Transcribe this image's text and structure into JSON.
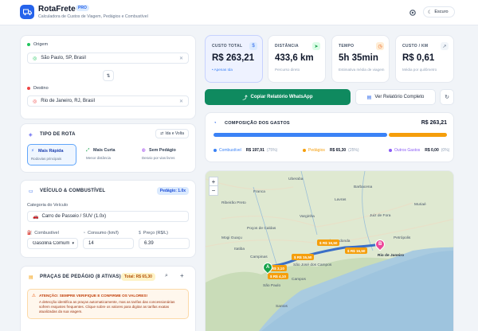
{
  "app": {
    "brand": "RotaFrete",
    "badge": "PRO",
    "tagline": "Calculadora de Custos de Viagem, Pedágios e Combustível",
    "theme_button": "Escuro"
  },
  "route": {
    "origin_label": "Origem",
    "origin_value": "São Paulo, SP, Brasil",
    "destination_label": "Destino",
    "destination_value": "Rio de Janeiro, RJ, Brasil"
  },
  "route_type": {
    "title": "TIPO DE ROTA",
    "roundtrip_button": "Ida e Volta",
    "options": [
      {
        "label": "Mais Rápida",
        "sub": "Rodovias principais"
      },
      {
        "label": "Mais Curta",
        "sub": "Menor distância"
      },
      {
        "label": "Sem Pedágio",
        "sub": "Desvio por vias livres"
      }
    ]
  },
  "vehicle": {
    "title": "VEÍCULO & COMBUSTÍVEL",
    "toll_badge": "Pedágio: 1.0x",
    "category_label": "Categoria do Veículo",
    "category_value": "Carro de Passeio / SUV (1.0x)",
    "fuel_label": "Combustível",
    "fuel_value": "Gasolina Comum",
    "consumption_label": "Consumo (km/l)",
    "consumption_value": "14",
    "price_label": "Preço (R$/L)",
    "price_value": "6.39"
  },
  "tolls": {
    "title": "PRAÇAS DE PEDÁGIO (8 ATIVAS)",
    "total_badge": "Total: R$ 65,30",
    "warning_title": "ATENÇÃO: SEMPRE VERIFIQUE E CONFIRME OS VALORES!",
    "warning_text": "A detecção identifica as praças automaticamente, mas as tarifas das concessionárias sofrem reajustes frequentes. Clique sobre os valores para digitar as tarifas exatas atualizadas da sua viagem."
  },
  "stats": [
    {
      "title": "CUSTO TOTAL",
      "value": "R$ 263,21",
      "sub": "• Apenas Ida",
      "icon": "dollar-icon"
    },
    {
      "title": "DISTÂNCIA",
      "value": "433,6 km",
      "sub": "Percurso direto",
      "icon": "navigation-icon"
    },
    {
      "title": "TEMPO",
      "value": "5h 35min",
      "sub": "Estimativa média de viagem",
      "icon": "clock-icon"
    },
    {
      "title": "CUSTO / KM",
      "value": "R$ 0,61",
      "sub": "Média por quilômetro",
      "icon": "trend-icon"
    }
  ],
  "actions": {
    "whatsapp": "Copiar Relatório WhatsApp",
    "report": "Ver Relatório Completo"
  },
  "composition": {
    "title": "COMPOSIÇÃO DOS GASTOS",
    "total": "R$ 263,21",
    "segments": [
      {
        "name": "Combustível",
        "value": "R$ 197,91",
        "pct": "(75%)",
        "fraction": 0.75,
        "color": "#3b82f6"
      },
      {
        "name": "Pedágios",
        "value": "R$ 65,30",
        "pct": "(25%)",
        "fraction": 0.25,
        "color": "#f59e0b"
      },
      {
        "name": "Outros Gastos",
        "value": "R$ 0,00",
        "pct": "(0%)",
        "fraction": 0.0,
        "color": "#8b5cf6"
      }
    ]
  },
  "map": {
    "zoom_in": "+",
    "zoom_out": "−",
    "marker_a": "A",
    "marker_b": "B",
    "toll_tags": [
      "$ R$ 16,50",
      "$ R$ 16,50",
      "$ R$ 15,50",
      "$ R$ 3,10",
      "$ R$ 4,10"
    ],
    "places": [
      "Ribeirão Preto",
      "Franca",
      "Uberaba",
      "Poços de Caldas",
      "Varginha",
      "Lavras",
      "Juiz de Fora",
      "Barbacena",
      "Muriaé",
      "Campinas",
      "São Paulo",
      "Santos",
      "Petrópolis",
      "Rio de Janeiro",
      "São José dos Campos",
      "Volta Redonda",
      "Campos",
      "Itatiba",
      "Mogi Guaçu"
    ]
  }
}
